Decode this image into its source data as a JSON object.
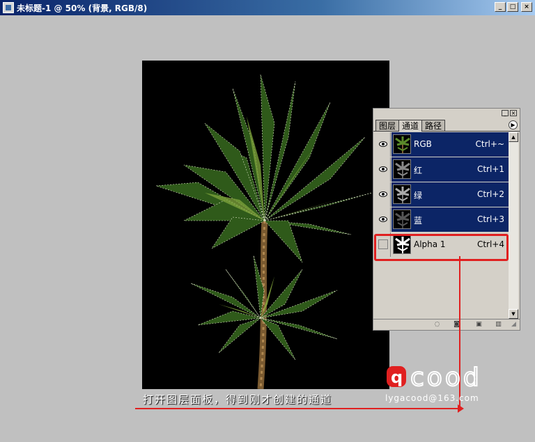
{
  "window": {
    "title": "未标题-1 @ 50% (背景, RGB/8)"
  },
  "panel": {
    "tabs": [
      "图层",
      "通道",
      "路径"
    ],
    "active_tab": "通道",
    "channels": [
      {
        "name": "RGB",
        "shortcut": "Ctrl+~",
        "visible": true,
        "selected": true
      },
      {
        "name": "红",
        "shortcut": "Ctrl+1",
        "visible": true,
        "selected": true
      },
      {
        "name": "绿",
        "shortcut": "Ctrl+2",
        "visible": true,
        "selected": true
      },
      {
        "name": "蓝",
        "shortcut": "Ctrl+3",
        "visible": true,
        "selected": true
      },
      {
        "name": "Alpha 1",
        "shortcut": "Ctrl+4",
        "visible": false,
        "selected": false
      }
    ],
    "footer_icons": [
      "load-selection-icon",
      "save-selection-icon",
      "new-channel-icon",
      "delete-channel-icon"
    ]
  },
  "annotation": {
    "caption": "打开图层面板，得到刚才创建的通道",
    "highlight_color": "#e02020"
  },
  "watermark": {
    "logo": "qcood",
    "email": "lygacood@163.com"
  },
  "colors": {
    "selected_row": "#0c2566",
    "panel_bg": "#d4d0c8",
    "workspace": "#c0c0c0"
  }
}
